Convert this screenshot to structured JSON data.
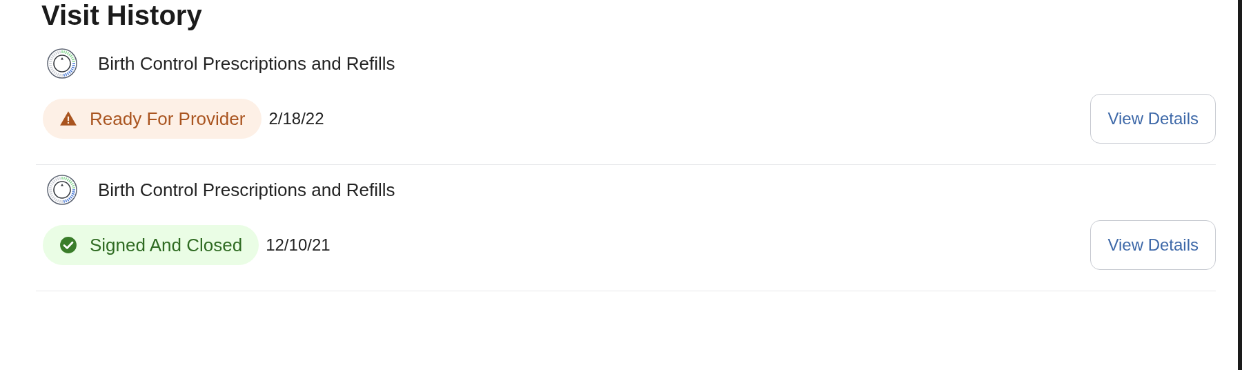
{
  "title": "Visit History",
  "visits": [
    {
      "name": "Birth Control Prescriptions and Refills",
      "status": {
        "kind": "warning",
        "label": "Ready For Provider"
      },
      "date": "2/18/22",
      "action": "View Details"
    },
    {
      "name": "Birth Control Prescriptions and Refills",
      "status": {
        "kind": "success",
        "label": "Signed And Closed"
      },
      "date": "12/10/21",
      "action": "View Details"
    }
  ]
}
